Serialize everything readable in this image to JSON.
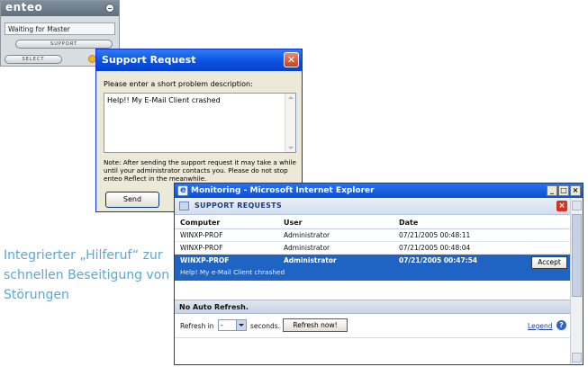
{
  "enteo_widget": {
    "logo": "enteo",
    "status": "Waiting for Master",
    "support_button": "SUPPORT",
    "select_button": "SELECT"
  },
  "support_dialog": {
    "title": "Support Request",
    "close_glyph": "✕",
    "prompt": "Please enter a short problem description:",
    "description": "Help!! My E-Mail Client crashed",
    "note": "Note: After sending the support request it may take a while until your administrator contacts you. Please do not stop enteo Reflect in the meanwhile.",
    "send_button": "Send"
  },
  "caption": "Integrierter „Hilferuf“ zur schnellen Beseitigung von Störungen",
  "ie_window": {
    "title": "Monitoring - Microsoft Internet Explorer",
    "window_buttons": [
      "_",
      "□",
      "×"
    ],
    "panel_title": "SUPPORT REQUESTS",
    "panel_close": "×",
    "columns": [
      "Computer",
      "User",
      "Date"
    ],
    "rows": [
      {
        "computer": "WINXP-PROF",
        "user": "Administrator",
        "date": "07/21/2005 00:48:11"
      },
      {
        "computer": "WINXP-PROF",
        "user": "Administrator",
        "date": "07/21/2005 00:48:04"
      }
    ],
    "selected_row": {
      "computer": "WINXP-PROF",
      "user": "Administrator",
      "date": "07/21/2005 00:47:54",
      "message": "Help! My e-Mail Client chrashed",
      "accept_button": "Accept"
    },
    "auto_refresh_label": "No Auto Refresh.",
    "refresh_prefix": "Refresh in",
    "refresh_value": "-",
    "refresh_suffix": "seconds.",
    "refresh_button": "Refresh now!",
    "legend_link": "Legend",
    "help_glyph": "?"
  },
  "colors": {
    "xp_blue": "#0a52e0",
    "selection_blue": "#1f64c2",
    "caption_blue": "#5aa8d8"
  }
}
